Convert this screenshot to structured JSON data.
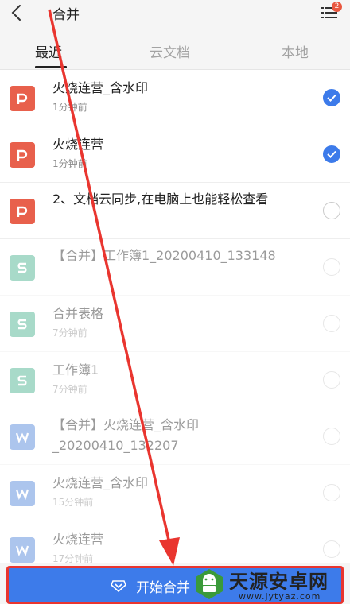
{
  "header": {
    "title": "合并",
    "badge_count": "2"
  },
  "tabs": [
    {
      "label": "最近",
      "active": true
    },
    {
      "label": "云文档",
      "active": false
    },
    {
      "label": "本地",
      "active": false
    }
  ],
  "files": [
    {
      "name": "火烧连营_含水印",
      "time": "1分钟前",
      "type": "ppt",
      "checked": true
    },
    {
      "name": "火烧连营",
      "time": "1分钟前",
      "type": "ppt",
      "checked": true
    },
    {
      "name": "2、文档云同步,在电脑上也能轻松查看",
      "time": "",
      "type": "ppt",
      "checked": false
    },
    {
      "name": "【合并】工作簿1_20200410_133148",
      "time": "",
      "type": "sheet",
      "checked": false
    },
    {
      "name": "合并表格",
      "time": "7分钟前",
      "type": "sheet",
      "checked": false
    },
    {
      "name": "工作簿1",
      "time": "7分钟前",
      "type": "sheet",
      "checked": false
    },
    {
      "name": "【合并】火烧连营_含水印_20200410_132207",
      "time": "",
      "type": "word",
      "checked": false
    },
    {
      "name": "火烧连营_含水印",
      "time": "15分钟前",
      "type": "word",
      "checked": false
    },
    {
      "name": "火烧连营",
      "time": "17分钟前",
      "type": "word",
      "checked": false
    }
  ],
  "bottom": {
    "start_label": "开始合并"
  },
  "watermark": {
    "title": "天源安卓网",
    "url": "www.jytyaz.com"
  },
  "colors": {
    "ppt": "#e8604c",
    "sheet": "#3fae8a",
    "word": "#4a7fd9",
    "accent": "#3d7bea",
    "annotation": "#e9352f"
  }
}
